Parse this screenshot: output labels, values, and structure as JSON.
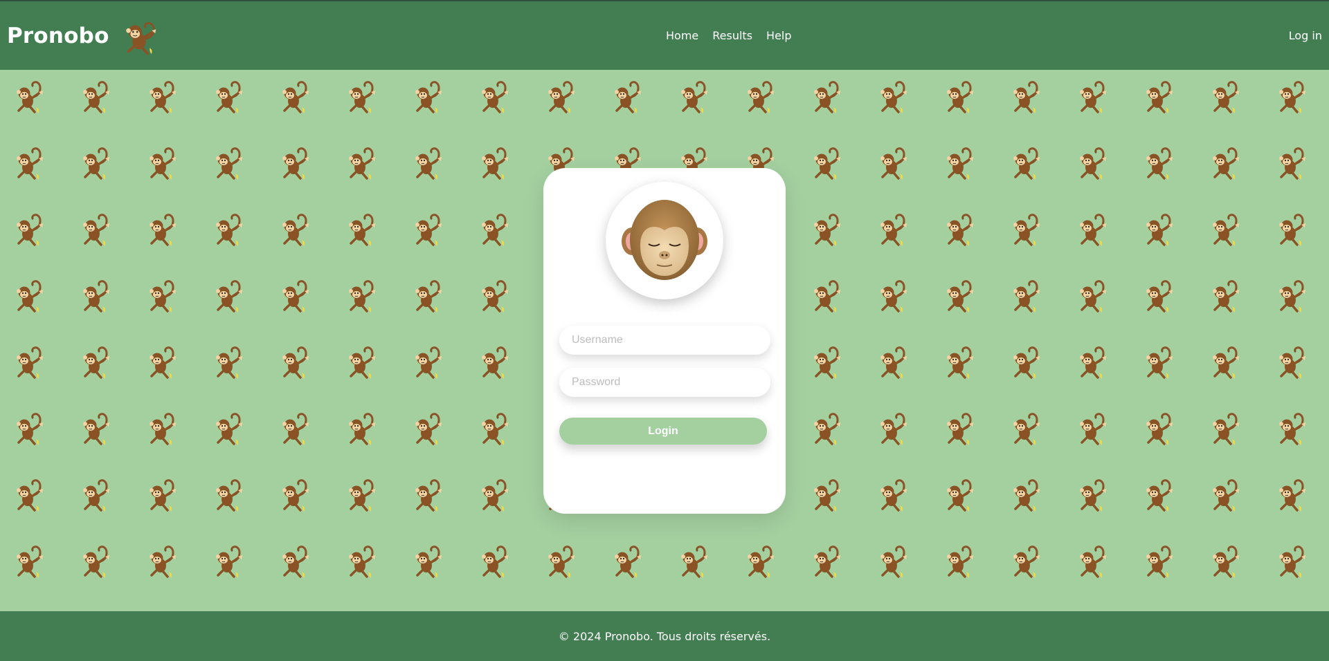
{
  "header": {
    "brand_name": "Pronobo",
    "logo_icon": "monkey-icon",
    "nav": [
      {
        "label": "Home"
      },
      {
        "label": "Results"
      },
      {
        "label": "Help"
      }
    ],
    "login_label": "Log in"
  },
  "background": {
    "pattern_icon": "monkey-icon",
    "color": "#a4d0a0"
  },
  "login_card": {
    "avatar_icon": "sleeping-monkey-face-icon",
    "username_placeholder": "Username",
    "password_placeholder": "Password",
    "submit_label": "Login"
  },
  "footer": {
    "copyright": "© 2024 Pronobo. Tous droits réservés."
  },
  "colors": {
    "header": "#437e53",
    "accent": "#a4d0a0",
    "card": "#ffffff"
  }
}
